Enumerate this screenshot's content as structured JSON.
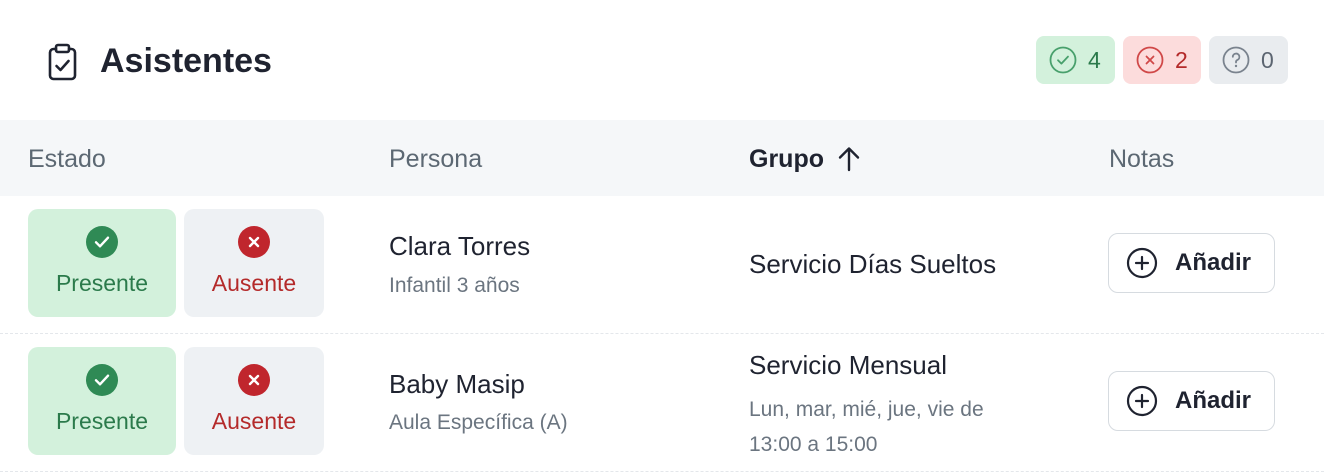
{
  "header": {
    "title": "Asistentes",
    "counts": {
      "present": "4",
      "absent": "2",
      "unknown": "0"
    }
  },
  "table": {
    "columns": [
      "Estado",
      "Persona",
      "Grupo",
      "Notas"
    ],
    "sorted_column": "Grupo",
    "sort_direction": "ascending",
    "rows": [
      {
        "present_label": "Presente",
        "absent_label": "Ausente",
        "selected_status": "Presente",
        "person_name": "Clara Torres",
        "person_group": "Infantil 3 años",
        "group_name": "Servicio Días Sueltos",
        "group_schedule": "",
        "notes_button": "Añadir"
      },
      {
        "present_label": "Presente",
        "absent_label": "Ausente",
        "selected_status": "Presente",
        "person_name": "Baby Masip",
        "person_group": "Aula Específica (A)",
        "group_name": "Servicio Mensual",
        "group_schedule_days": "Lun, mar, mié, jue, vie de",
        "group_schedule_time": "13:00 a 15:00",
        "notes_button": "Añadir"
      }
    ]
  },
  "icons": {
    "title": "clipboard-check-icon",
    "present": "check-circle-icon",
    "absent": "x-circle-icon",
    "unknown": "question-circle-icon",
    "sort": "arrow-up-icon",
    "add": "plus-circle-icon"
  },
  "colors": {
    "present_bg": "#d3f1dc",
    "present_fg": "#2b7a4b",
    "present_icon": "#2f8a55",
    "absent_bg": "#fcdcdc",
    "absent_fg": "#b42a2a",
    "absent_icon": "#c0262d",
    "neutral_bg": "#e9ecef",
    "header_bg": "#f5f7f9"
  }
}
